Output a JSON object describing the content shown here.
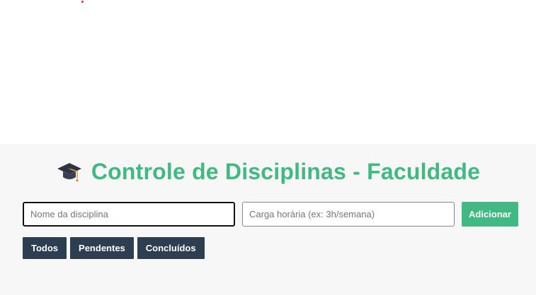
{
  "header": {
    "icon": "graduation-cap-icon",
    "title": "Controle de Disciplinas - Faculdade"
  },
  "form": {
    "name_placeholder": "Nome da disciplina",
    "name_value": "",
    "hours_placeholder": "Carga horária (ex: 3h/semana)",
    "hours_value": "",
    "add_label": "Adicionar"
  },
  "filters": [
    {
      "label": "Todos"
    },
    {
      "label": "Pendentes"
    },
    {
      "label": "Concluídos"
    }
  ],
  "colors": {
    "accent": "#42b883",
    "filter_bg": "#2c3e50",
    "app_bg": "#f7f7f7"
  }
}
